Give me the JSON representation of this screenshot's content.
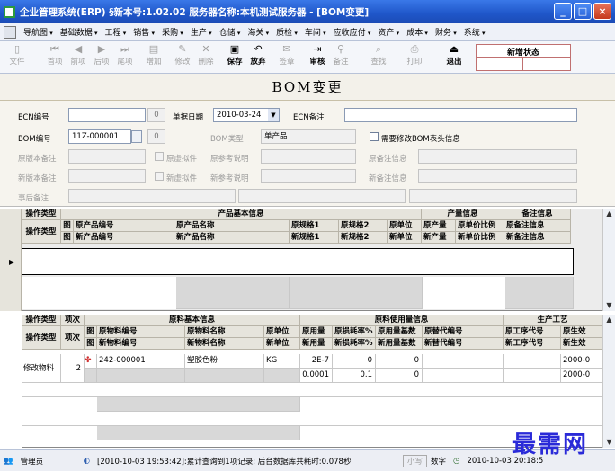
{
  "window": {
    "title": "企业管理系统(ERP) §新本号:1.02.02  服务器名称:本机测试服务器 - [BOM变更]",
    "minimize": "_",
    "maximize": "□",
    "close": "×"
  },
  "menu": [
    "导航图",
    "基础数据",
    "工程",
    "销售",
    "采购",
    "生产",
    "仓储",
    "海关",
    "质检",
    "车间",
    "应收应付",
    "资产",
    "成本",
    "财务",
    "系统"
  ],
  "toolbar": [
    {
      "label": "文件",
      "icon": "▯",
      "enabled": false
    },
    {
      "label": "首项",
      "icon": "⏮",
      "enabled": false
    },
    {
      "label": "前项",
      "icon": "◀",
      "enabled": false
    },
    {
      "label": "后项",
      "icon": "▶",
      "enabled": false
    },
    {
      "label": "尾项",
      "icon": "⏭",
      "enabled": false
    },
    {
      "label": "增加",
      "icon": "▤",
      "enabled": false
    },
    {
      "label": "修改",
      "icon": "✎",
      "enabled": false
    },
    {
      "label": "删除",
      "icon": "✕",
      "enabled": false
    },
    {
      "label": "保存",
      "icon": "▣",
      "enabled": true
    },
    {
      "label": "放弃",
      "icon": "↶",
      "enabled": true
    },
    {
      "label": "签章",
      "icon": "✉",
      "enabled": false
    },
    {
      "label": "审核",
      "icon": "⇥",
      "enabled": true
    },
    {
      "label": "备注",
      "icon": "⚲",
      "enabled": false
    },
    {
      "label": "查找",
      "icon": "⌕",
      "enabled": false
    },
    {
      "label": "打印",
      "icon": "⎙",
      "enabled": false
    },
    {
      "label": "退出",
      "icon": "⏏",
      "enabled": true
    }
  ],
  "status_box_label": "新增状态",
  "form_title": "BOM变更",
  "form": {
    "ecn_no_label": "ECN编号",
    "ecn_no_value": "",
    "ecn_spin": "0",
    "date_label": "单据日期",
    "date_value": "2010-03-24",
    "ecn_note_label": "ECN备注",
    "bom_no_label": "BOM编号",
    "bom_no_value": "11Z-000001",
    "bom_btn": "...",
    "bom_spin": "0",
    "bom_type_label": "BOM类型",
    "bom_type_value": "单产品",
    "need_modify_label": "需要修改BOM表头信息",
    "orig_note_label": "原版本备注",
    "orig_virtual_label": "原虚拟件",
    "orig_ref_label": "原参考说明",
    "orig_remark_label": "原备注信息",
    "new_note_label": "新版本备注",
    "new_virtual_label": "新虚拟件",
    "new_ref_label": "新参考说明",
    "new_remark_label": "新备注信息",
    "post_note_label": "事后备注"
  },
  "grid1": {
    "group_headers": {
      "op": "操作类型",
      "basic": "产品基本信息",
      "qty": "产量信息",
      "remark": "备注信息"
    },
    "row1": [
      "操作类型",
      "图",
      "原产品编号",
      "原产品名称",
      "原规格1",
      "原规格2",
      "原单位",
      "原产量",
      "原单价比例",
      "原备注信息"
    ],
    "row2": [
      "",
      "图",
      "新产品编号",
      "新产品名称",
      "新规格1",
      "新规格2",
      "新单位",
      "新产量",
      "新单价比例",
      "新备注信息"
    ]
  },
  "grid2": {
    "group_headers": {
      "op": "操作类型",
      "seq": "项次",
      "basic": "原料基本信息",
      "usage": "原料使用量信息",
      "process": "生产工艺"
    },
    "row1": [
      "操作类型",
      "项次",
      "图",
      "原物料编号",
      "原物料名称",
      "原单位",
      "原用量",
      "原损耗率%",
      "原用量基数",
      "原替代编号",
      "原工序代号",
      "原生效"
    ],
    "row2": [
      "",
      "",
      "图",
      "新物料编号",
      "新物料名称",
      "新单位",
      "新用量",
      "新损耗率%",
      "新用量基数",
      "新替代编号",
      "新工序代号",
      "新生效"
    ],
    "data": {
      "op": "修改物料",
      "seq": "2",
      "material_no": "242-000001",
      "material_name": "塑胶色粉",
      "unit": "KG",
      "orig_qty": "2E-7",
      "orig_loss": "0",
      "orig_base": "0",
      "new_qty": "0.0001",
      "new_loss": "0.1",
      "new_base": "0",
      "orig_date": "2000-0",
      "new_date": "2000-0"
    }
  },
  "statusbar": {
    "user": "管理员",
    "message": "[2010-10-03 19:53:42]:累计查询到1项记录; 后台数据库共耗时:0.078秒",
    "caps": "小写",
    "num": "数字",
    "clock": "2010-10-03 20:18:5"
  },
  "watermark": "最需网"
}
